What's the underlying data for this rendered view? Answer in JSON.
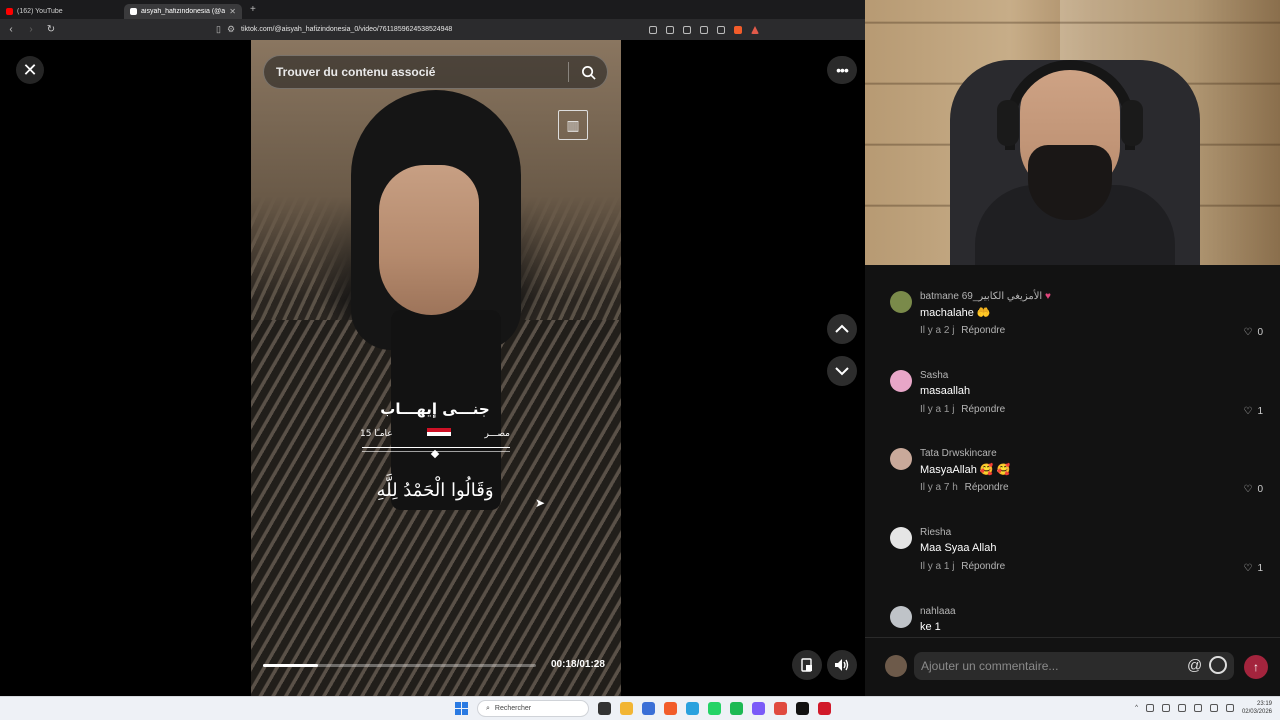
{
  "browser": {
    "tabs": [
      {
        "title": "(162) YouTube",
        "active": false,
        "favicon_color": "#ff0000"
      },
      {
        "title": "aisyah_hafizindonesia (@aisy",
        "active": true,
        "favicon_color": "#ffffff"
      }
    ],
    "url": "tiktok.com/@aisyah_hafizindonesia_0/video/7611859624538524948"
  },
  "player": {
    "search_placeholder": "Trouver du contenu associé",
    "overlay_name": "جنـــى إيهـــاب",
    "overlay_country": "مصـــر",
    "overlay_age": "15 عامـًا",
    "overlay_verse": "وَقَالُوا الْحَمْدُ لِلَّهِ",
    "timecode": "00:18/01:28",
    "progress_fraction": 0.2
  },
  "comments": [
    {
      "user": "batmane 69_الأمزيغي الكابير",
      "text": "machalahe 🤲",
      "time": "Il y a 2 j",
      "reply": "Répondre",
      "likes": "0",
      "avatar_color": "#7a8a4a"
    },
    {
      "user": "Sasha",
      "text": "masaallah",
      "time": "Il y a 1 j",
      "reply": "Répondre",
      "likes": "1",
      "avatar_color": "#e8a6c8"
    },
    {
      "user": "Tata Drwskincare",
      "text": "MasyaAllah 🥰 🥰",
      "time": "Il y a 7 h",
      "reply": "Répondre",
      "likes": "0",
      "avatar_color": "#c9a99a"
    },
    {
      "user": "Riesha",
      "text": "Maa Syaa Allah",
      "time": "Il y a 1 j",
      "reply": "Répondre",
      "likes": "1",
      "avatar_color": "#e5e5e5"
    },
    {
      "user": "nahlaaa",
      "text": "ke 1",
      "time": "",
      "reply": "",
      "likes": "",
      "avatar_color": "#bfc3c8"
    }
  ],
  "comment_input": {
    "placeholder": "Ajouter un commentaire..."
  },
  "taskbar": {
    "search_label": "Rechercher",
    "time": "23:19",
    "date": "02/03/2026"
  }
}
